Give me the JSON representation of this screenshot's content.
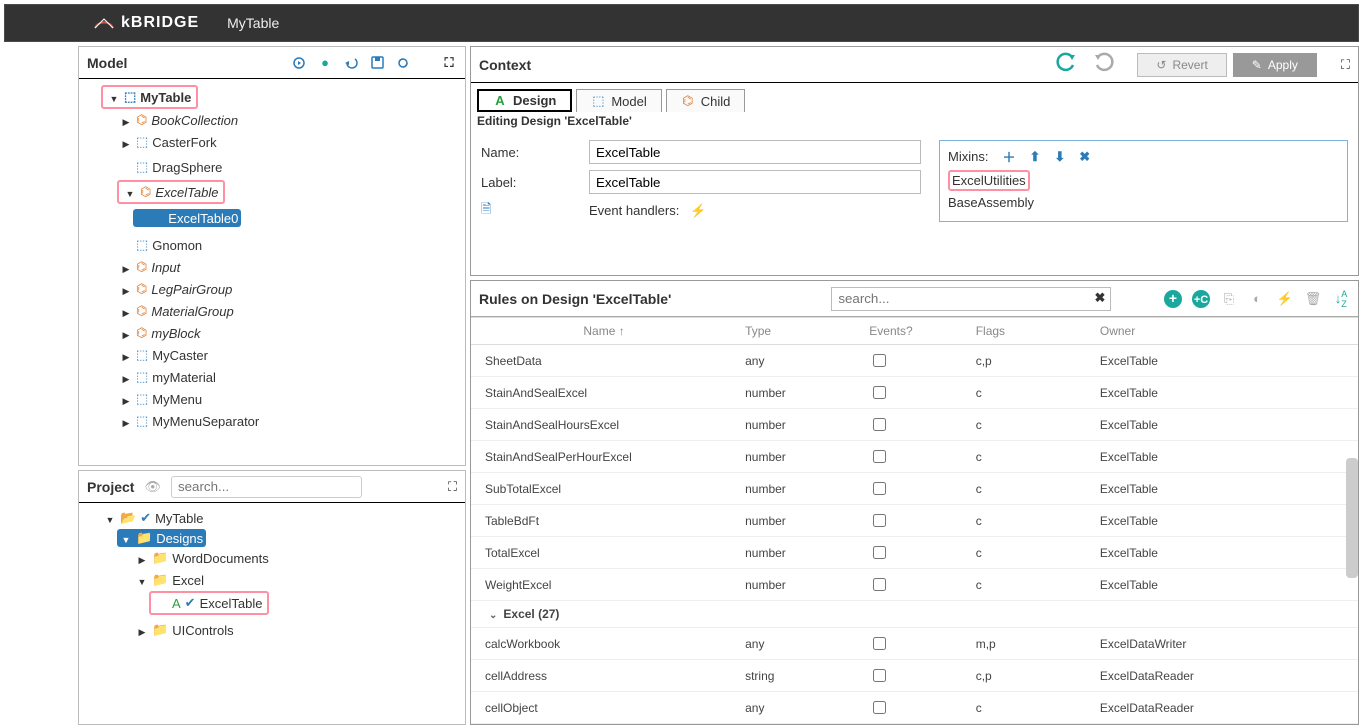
{
  "app": {
    "brand": "kBRIDGE",
    "title": "MyTable"
  },
  "model": {
    "panel_label": "Model",
    "root": "MyTable",
    "items": [
      {
        "label": "BookCollection",
        "icon": "org",
        "italic": true,
        "caret": "right"
      },
      {
        "label": "CasterFork",
        "icon": "cube",
        "caret": "right"
      },
      {
        "label": "DragSphere",
        "icon": "cube",
        "caret": "none"
      },
      {
        "label": "ExcelTable",
        "icon": "org",
        "italic": true,
        "caret": "down",
        "highlight": true,
        "children": [
          {
            "label": "ExcelTable0",
            "icon": "cube",
            "selected": true
          }
        ]
      },
      {
        "label": "Gnomon",
        "icon": "cube",
        "caret": "none"
      },
      {
        "label": "Input",
        "icon": "org",
        "italic": true,
        "caret": "right"
      },
      {
        "label": "LegPairGroup",
        "icon": "org",
        "italic": true,
        "caret": "right"
      },
      {
        "label": "MaterialGroup",
        "icon": "org",
        "italic": true,
        "caret": "right"
      },
      {
        "label": "myBlock",
        "icon": "org",
        "italic": true,
        "caret": "right"
      },
      {
        "label": "MyCaster",
        "icon": "cube",
        "caret": "right"
      },
      {
        "label": "myMaterial",
        "icon": "cube",
        "caret": "right"
      },
      {
        "label": "MyMenu",
        "icon": "cube",
        "caret": "right"
      },
      {
        "label": "MyMenuSeparator",
        "icon": "cube",
        "caret": "right"
      }
    ]
  },
  "project": {
    "panel_label": "Project",
    "search_placeholder": "search...",
    "root": "MyTable",
    "designs_label": "Designs",
    "folders": [
      {
        "label": "WordDocuments",
        "caret": "right"
      },
      {
        "label": "Excel",
        "caret": "down",
        "children": [
          {
            "label": "ExcelTable",
            "highlight": true
          }
        ]
      },
      {
        "label": "UIControls",
        "caret": "right"
      }
    ]
  },
  "context": {
    "panel_label": "Context",
    "revert": "Revert",
    "apply": "Apply",
    "tabs": {
      "design": "Design",
      "model": "Model",
      "child": "Child"
    },
    "editing": "Editing Design 'ExcelTable'",
    "name_label": "Name:",
    "name_value": "ExcelTable",
    "label_label": "Label:",
    "label_value": "ExcelTable",
    "events_label": "Event handlers:",
    "mixins_label": "Mixins:",
    "mixins": [
      "ExcelUtilities",
      "BaseAssembly"
    ],
    "mixin_highlight": 0
  },
  "rules": {
    "heading": "Rules on Design 'ExcelTable'",
    "search_placeholder": "search...",
    "cols": {
      "name": "Name ↑",
      "type": "Type",
      "events": "Events?",
      "flags": "Flags",
      "owner": "Owner"
    },
    "rows": [
      {
        "name": "SheetData",
        "type": "any",
        "flags": "c,p",
        "owner": "ExcelTable"
      },
      {
        "name": "StainAndSealExcel",
        "type": "number",
        "flags": "c",
        "owner": "ExcelTable"
      },
      {
        "name": "StainAndSealHoursExcel",
        "type": "number",
        "flags": "c",
        "owner": "ExcelTable"
      },
      {
        "name": "StainAndSealPerHourExcel",
        "type": "number",
        "flags": "c",
        "owner": "ExcelTable"
      },
      {
        "name": "SubTotalExcel",
        "type": "number",
        "flags": "c",
        "owner": "ExcelTable"
      },
      {
        "name": "TableBdFt",
        "type": "number",
        "flags": "c",
        "owner": "ExcelTable"
      },
      {
        "name": "TotalExcel",
        "type": "number",
        "flags": "c",
        "owner": "ExcelTable"
      },
      {
        "name": "WeightExcel",
        "type": "number",
        "flags": "c",
        "owner": "ExcelTable"
      }
    ],
    "group_label": "Excel (27)",
    "rows2": [
      {
        "name": "calcWorkbook",
        "type": "any",
        "flags": "m,p",
        "owner": "ExcelDataWriter"
      },
      {
        "name": "cellAddress",
        "type": "string",
        "flags": "c,p",
        "owner": "ExcelDataReader"
      },
      {
        "name": "cellObject",
        "type": "any",
        "flags": "c",
        "owner": "ExcelDataReader"
      }
    ]
  }
}
